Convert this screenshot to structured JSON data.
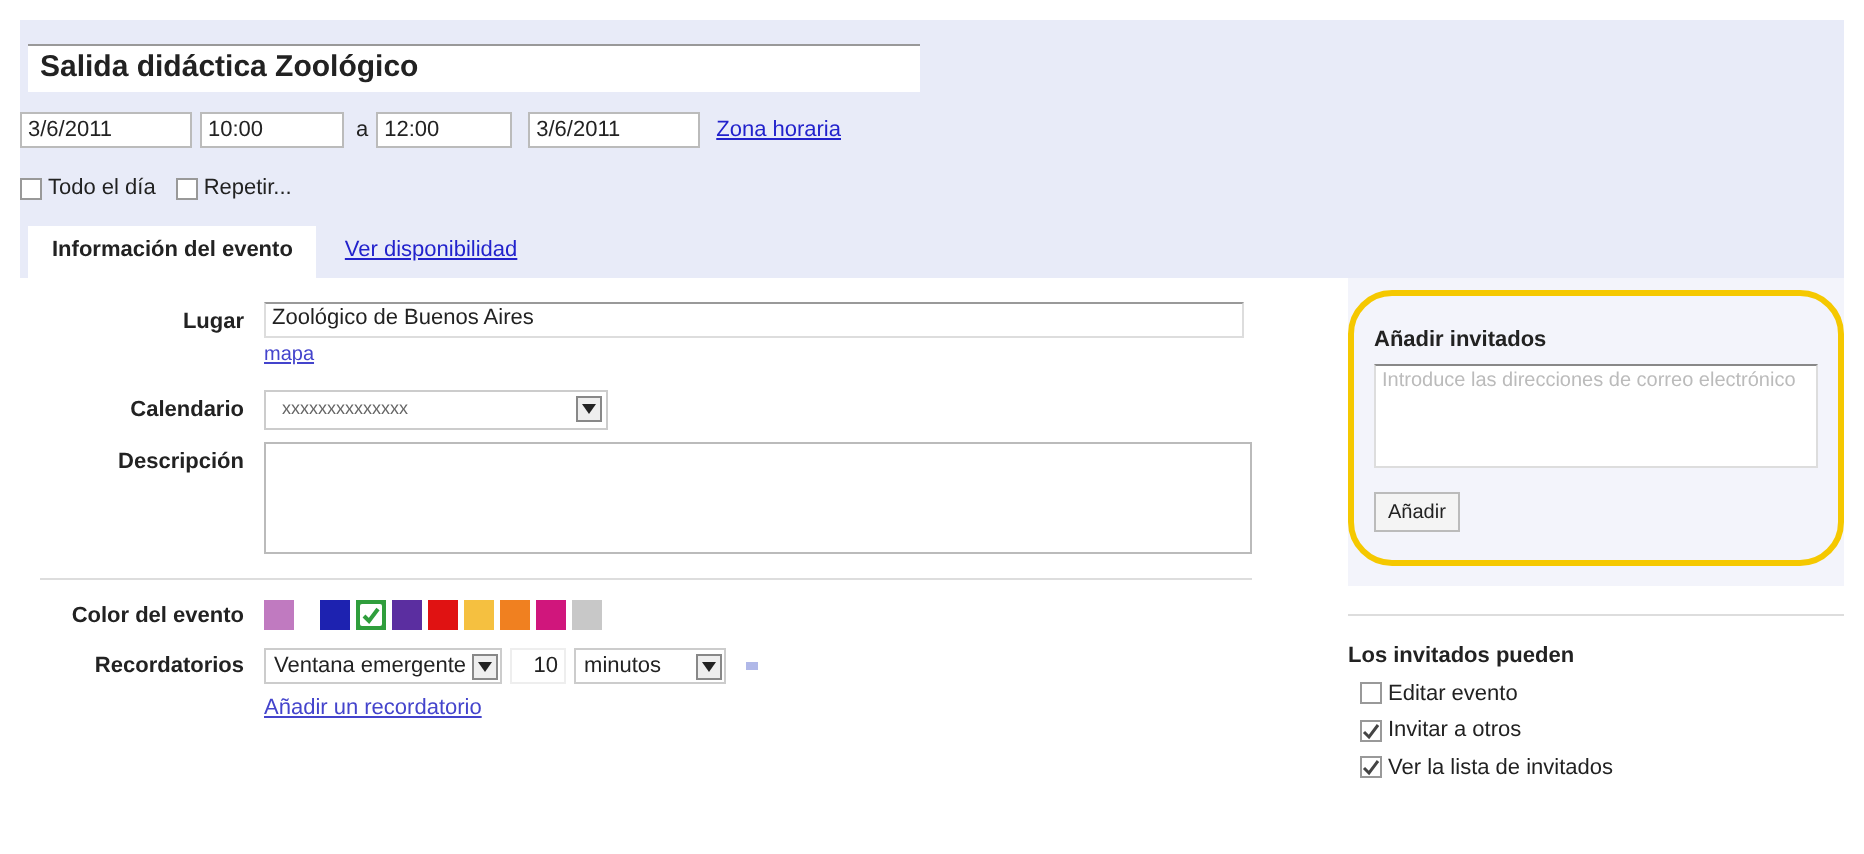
{
  "event": {
    "title": "Salida didáctica Zoológico",
    "start_date": "3/6/2011",
    "start_time": "10:00",
    "separator": "a",
    "end_time": "12:00",
    "end_date": "3/6/2011",
    "timezone_link": "Zona horaria"
  },
  "options": [
    {
      "label": "Todo el día",
      "checked": false
    },
    {
      "label": "Repetir...",
      "checked": false
    }
  ],
  "tabs": [
    {
      "label": "Información del evento",
      "selected": true
    },
    {
      "label": "Ver disponibilidad",
      "selected": false
    }
  ],
  "details": {
    "place_label": "Lugar",
    "place_value": "Zoológico de Buenos Aires",
    "map_link": "mapa",
    "calendar_label": "Calendario",
    "calendar_value": "xxxxxxxxxxxxxx",
    "description_label": "Descripción"
  },
  "color_label": "Color del evento",
  "colors": [
    {
      "color": "#c07ac0",
      "selected": false
    },
    {
      "color": "#1d22b0",
      "selected": false
    },
    {
      "color": "#2f9e3c",
      "selected": true
    },
    {
      "color": "#5b2ea0",
      "selected": false
    },
    {
      "color": "#e01212",
      "selected": false
    },
    {
      "color": "#f5c040",
      "selected": false
    },
    {
      "color": "#f08020",
      "selected": false
    },
    {
      "color": "#d0167c",
      "selected": false
    },
    {
      "color": "#c8c8c8",
      "selected": false
    }
  ],
  "reminders": {
    "label": "Recordatorios",
    "method": "Ventana emergente",
    "amount": "10",
    "unit": "minutos",
    "add_link": "Añadir un recordatorio"
  },
  "guests": {
    "title": "Añadir invitados",
    "placeholder": "Introduce las direcciones de correo electrónico",
    "button": "Añadir",
    "highlighted": true
  },
  "permissions": {
    "title": "Los invitados pueden",
    "items": [
      {
        "label": "Editar evento",
        "checked": false
      },
      {
        "label": "Invitar a otros",
        "checked": true
      },
      {
        "label": "Ver la lista de invitados",
        "checked": true
      }
    ]
  }
}
